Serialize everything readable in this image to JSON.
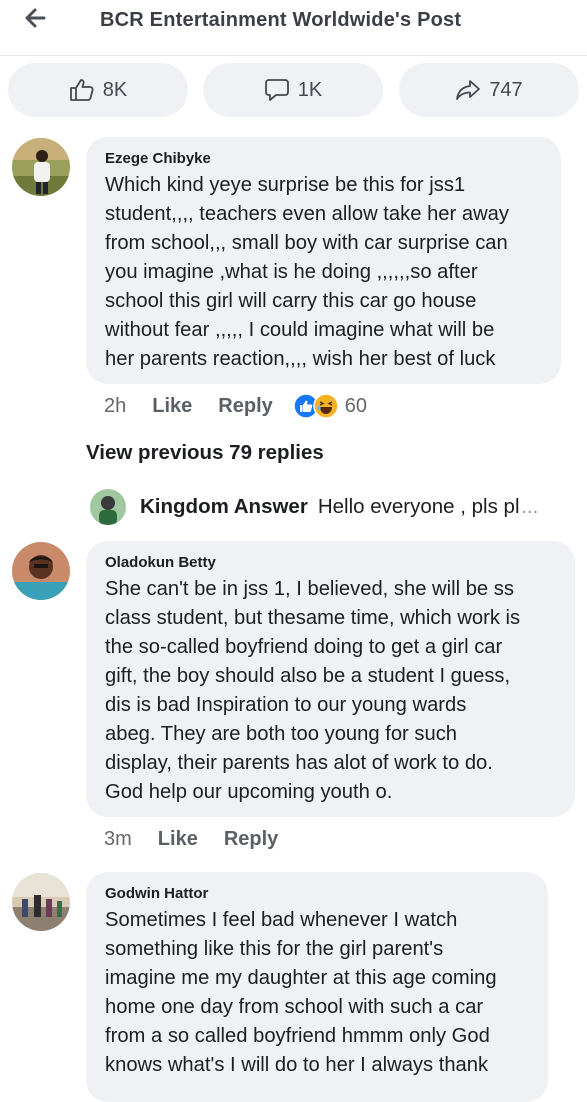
{
  "header": {
    "title": "BCR Entertainment Worldwide's Post"
  },
  "actions": {
    "likes": "8K",
    "comments": "1K",
    "shares": "747"
  },
  "comments": [
    {
      "author": "Ezege Chibyke",
      "lines": [
        "Which kind yeye surprise be this for jss1",
        "student,,,, teachers even allow take her away",
        "from school,,, small boy with car surprise can",
        "you imagine ,what is he doing ,,,,,,so after",
        "school this girl will carry this car go house",
        "without fear ,,,,, I could imagine what will be",
        "her parents reaction,,,, wish her best of luck"
      ],
      "time": "2h",
      "like": "Like",
      "reply": "Reply",
      "reaction_count": "60"
    },
    {
      "author": "Oladokun Betty",
      "lines": [
        "She  can't be in jss 1, I believed, she will be ss",
        "class student, but thesame time, which work is",
        "the so-called boyfriend doing to get a girl car",
        "gift, the boy should also be a student I guess,",
        "dis is bad Inspiration to our young wards",
        "abeg. They are both too young for such",
        "display, their parents has alot of work to do.",
        "God help our upcoming youth o."
      ],
      "time": "3m",
      "like": "Like",
      "reply": "Reply"
    },
    {
      "author": "Godwin Hattor",
      "lines": [
        "Sometimes I feel bad whenever I watch",
        "something like this for the girl parent's",
        "imagine me my daughter at this age coming",
        "home one day from school with such a car",
        "from a so called boyfriend hmmm only God",
        "knows what's I will do to her I always thank"
      ]
    }
  ],
  "view_previous": "View previous 79 replies",
  "reply_preview": {
    "name": "Kingdom Answer",
    "text": "Hello everyone , pls pl",
    "ellipsis": "..."
  },
  "colors": {
    "bubble": "#eff1f4",
    "like_blue": "#1877f2",
    "haha_yellow": "#f7b125"
  }
}
